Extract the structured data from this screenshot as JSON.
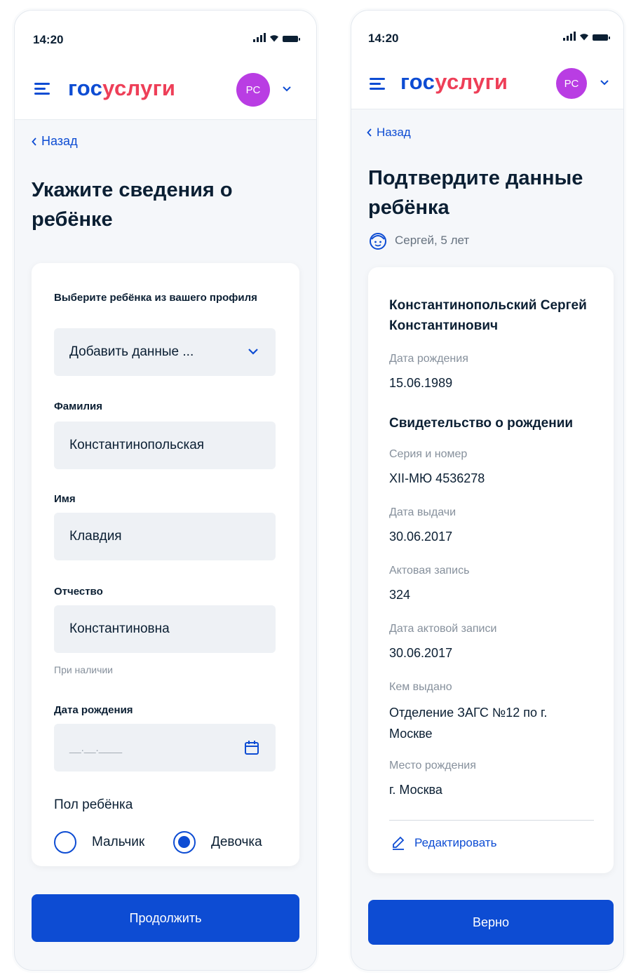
{
  "status_bar": {
    "time": "14:20"
  },
  "header": {
    "logo_part1": "гос",
    "logo_part2": "услуги",
    "avatar_initials": "РС"
  },
  "screen_left": {
    "back_label": "Назад",
    "title": "Укажите сведения о ребёнке",
    "select_child_label": "Выберите ребёнка из вашего профиля",
    "select_child_value": "Добавить данные ...",
    "surname_label": "Фамилия",
    "surname_value": "Константинопольская",
    "name_label": "Имя",
    "name_value": "Клавдия",
    "patronymic_label": "Отчество",
    "patronymic_value": "Константиновна",
    "patronymic_hint": "При наличии",
    "birthdate_label": "Дата рождения",
    "birthdate_placeholder": "__.__.____",
    "gender_label": "Пол ребёнка",
    "gender_options": [
      "Мальчик",
      "Девочка"
    ],
    "gender_selected": "Девочка",
    "continue_label": "Продолжить"
  },
  "screen_right": {
    "back_label": "Назад",
    "title": "Подтвердите данные ребёнка",
    "subtitle": "Сергей, 5 лет",
    "full_name": "Константинопольский Сергей Константинович",
    "birth_date_label": "Дата рождения",
    "birth_date_value": "15.06.1989",
    "certificate_heading": "Свидетельство о рождении",
    "series_label": "Серия и номер",
    "series_value": "XII-МЮ 4536278",
    "issue_date_label": "Дата выдачи",
    "issue_date_value": "30.06.2017",
    "record_label": "Актовая запись",
    "record_value": "324",
    "record_date_label": "Дата актовой записи",
    "record_date_value": "30.06.2017",
    "issued_by_label": "Кем выдано",
    "issued_by_value": "Отделение ЗАГС №12 по г. Москве",
    "birth_place_label": "Место рождения",
    "birth_place_value": "г. Москва",
    "edit_label": "Редактировать",
    "confirm_label": "Верно"
  },
  "colors": {
    "primary": "#0d4cd3",
    "logo_accent": "#ee3f58",
    "avatar": "#b93de3",
    "background": "#f5f7fa"
  },
  "icons": [
    "menu-icon",
    "chevron-down-icon",
    "chevron-left-icon",
    "calendar-icon",
    "child-icon",
    "pencil-icon",
    "signal-icon",
    "wifi-icon",
    "battery-icon"
  ]
}
